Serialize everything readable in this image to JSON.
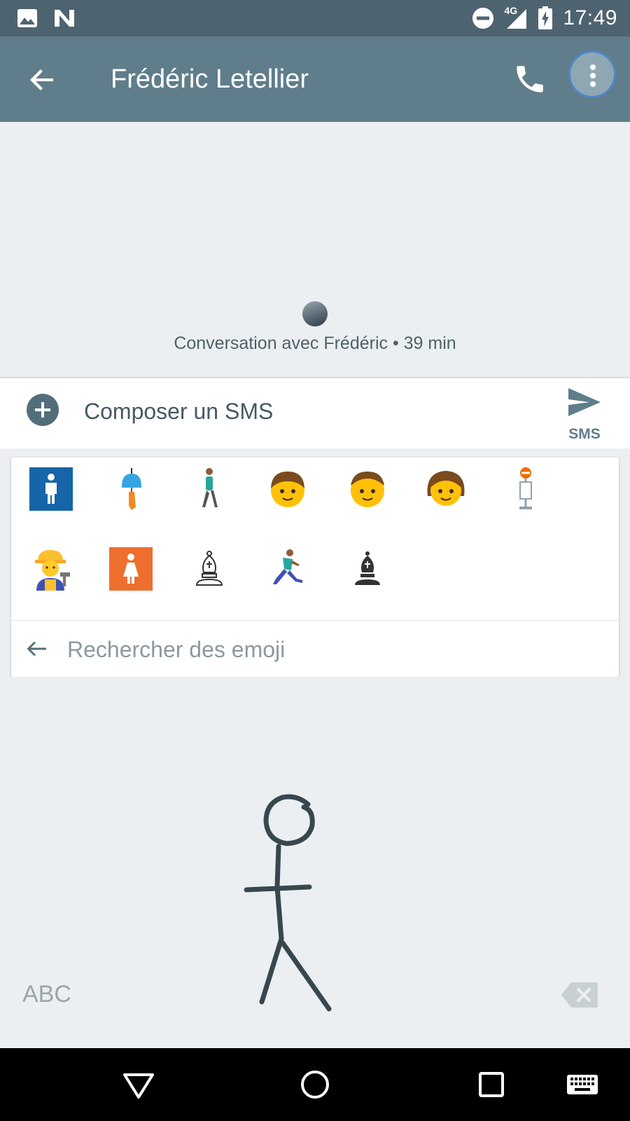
{
  "status_bar": {
    "time": "17:49",
    "network": "4G",
    "icons": [
      "image-icon",
      "n-icon",
      "do-not-disturb-icon",
      "signal-icon",
      "battery-charging-icon"
    ]
  },
  "header": {
    "title": "Frédéric Letellier",
    "icons": [
      "back-arrow-icon",
      "phone-icon",
      "more-vert-icon"
    ]
  },
  "conversation": {
    "info": "Conversation avec Frédéric • 39 min"
  },
  "compose": {
    "placeholder": "Composer un SMS",
    "send_label": "SMS"
  },
  "emoji_panel": {
    "results": [
      "mens-restroom-sign",
      "wind-chime",
      "person-walking",
      "boy-face",
      "boy-face-2",
      "girl-face",
      "bus-stop",
      "construction-worker",
      "womens-restroom-sign",
      "white-chess-bishop",
      "person-running",
      "black-chess-bishop"
    ],
    "search_placeholder": "Rechercher des emoji"
  },
  "handwriting": {
    "abc_label": "ABC",
    "icons": [
      "backspace-icon"
    ]
  },
  "nav_bar": {
    "icons": [
      "back-triangle-icon",
      "home-circle-icon",
      "recents-square-icon",
      "keyboard-icon"
    ]
  },
  "colors": {
    "status_bar": "#4e6370",
    "app_bar": "#607d8b",
    "background": "#eceff1",
    "ink": "#37474f"
  }
}
